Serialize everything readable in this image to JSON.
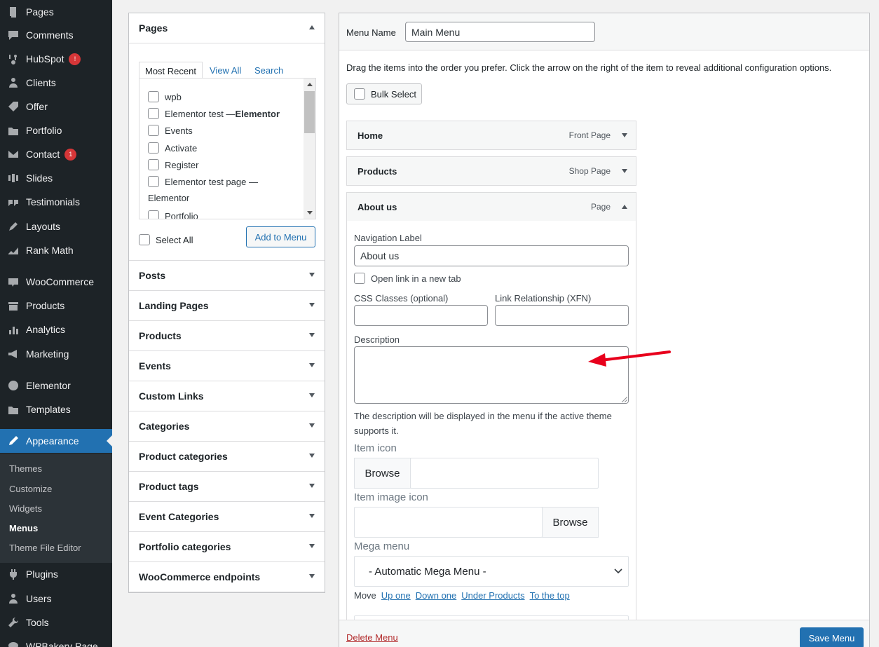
{
  "sidebar": {
    "items": [
      {
        "label": "Pages",
        "icon": "pages-icon",
        "top": 0
      },
      {
        "label": "Comments",
        "icon": "comments-icon"
      },
      {
        "label": "HubSpot",
        "icon": "hubspot-icon",
        "badge": "!"
      },
      {
        "label": "Clients",
        "icon": "clients-icon"
      },
      {
        "label": "Offer",
        "icon": "offer-icon"
      },
      {
        "label": "Portfolio",
        "icon": "portfolio-icon"
      },
      {
        "label": "Contact",
        "icon": "contact-icon",
        "badge": "1"
      },
      {
        "label": "Slides",
        "icon": "slides-icon"
      },
      {
        "label": "Testimonials",
        "icon": "testimonials-icon"
      },
      {
        "label": "Layouts",
        "icon": "layouts-icon"
      },
      {
        "label": "Rank Math",
        "icon": "rank-math-icon"
      },
      {
        "label": "WooCommerce",
        "icon": "woocommerce-icon"
      },
      {
        "label": "Products",
        "icon": "products-icon"
      },
      {
        "label": "Analytics",
        "icon": "analytics-icon"
      },
      {
        "label": "Marketing",
        "icon": "marketing-icon"
      },
      {
        "label": "Elementor",
        "icon": "elementor-icon"
      },
      {
        "label": "Templates",
        "icon": "templates-icon"
      },
      {
        "label": "Appearance",
        "icon": "appearance-icon"
      },
      {
        "label": "Plugins",
        "icon": "plugins-icon"
      },
      {
        "label": "Users",
        "icon": "users-icon"
      },
      {
        "label": "Tools",
        "icon": "tools-icon"
      },
      {
        "label": "WPBakery Page",
        "icon": "wpbakery-icon"
      }
    ],
    "submenu": [
      "Themes",
      "Customize",
      "Widgets",
      "Menus",
      "Theme File Editor"
    ]
  },
  "add_items": {
    "pages_title": "Pages",
    "tabs": [
      "Most Recent",
      "View All",
      "Search"
    ],
    "page_list": [
      "wpb",
      "Elementor test — ",
      "Elementor",
      "Events",
      "Activate",
      "Register",
      "Elementor test page —",
      "Elementor",
      "Portfolio"
    ],
    "select_all": "Select All",
    "add_to_menu": "Add to Menu",
    "sections": [
      "Posts",
      "Landing Pages",
      "Products",
      "Events",
      "Custom Links",
      "Categories",
      "Product categories",
      "Product tags",
      "Event Categories",
      "Portfolio categories",
      "WooCommerce endpoints"
    ]
  },
  "menu": {
    "name_label": "Menu Name",
    "name_value": "Main Menu",
    "instructions": "Drag the items into the order you prefer. Click the arrow on the right of the item to reveal additional configuration options.",
    "bulk_select": "Bulk Select",
    "items": [
      {
        "title": "Home",
        "type": "Front Page"
      },
      {
        "title": "Products",
        "type": "Shop Page"
      },
      {
        "title": "About us",
        "type": "Page"
      }
    ],
    "settings": {
      "nav_label": "Navigation Label",
      "nav_value": "About us",
      "new_tab": "Open link in a new tab",
      "css_classes": "CSS Classes (optional)",
      "xfn": "Link Relationship (XFN)",
      "description": "Description",
      "desc_help": "The description will be displayed in the menu if the active theme supports it.",
      "item_icon": "Item icon",
      "browse": "Browse",
      "item_image_icon": "Item image icon",
      "mega_menu": "Mega menu",
      "mega_value": "- Automatic Mega Menu -",
      "move": "Move",
      "move_links": [
        "Up one",
        "Down one",
        "Under Products",
        "To the top"
      ]
    },
    "delete": "Delete Menu",
    "save": "Save Menu"
  },
  "colors": {
    "accent": "#2271b1",
    "sidebar": "#1d2327",
    "arrow": "#e8001c"
  }
}
